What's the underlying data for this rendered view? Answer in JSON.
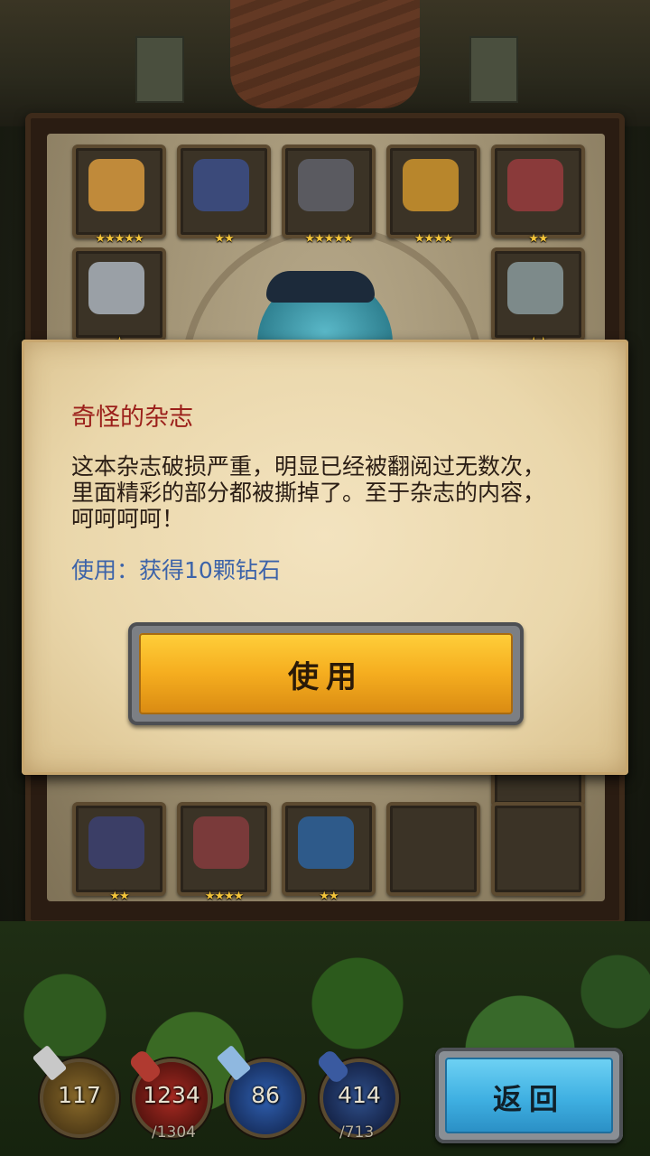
{
  "inventory": {
    "row1": [
      {
        "icon": "gauntlet-icon",
        "stars": "★★★★★",
        "color": "#c08a3a"
      },
      {
        "icon": "armor-vest-icon",
        "stars": "★★",
        "color": "#3b4a7a"
      },
      {
        "icon": "helmet-icon",
        "stars": "★★★★★",
        "color": "#5a5a60"
      },
      {
        "icon": "lantern-icon",
        "stars": "★★★★",
        "color": "#b8862c"
      },
      {
        "icon": "amulet-icon",
        "stars": "★★",
        "color": "#8a3a3a"
      }
    ],
    "row2": [
      {
        "icon": "silver-bracelet-icon",
        "stars": "★",
        "color": "#9aa0a6"
      },
      {
        "icon": "ring-icon",
        "stars": "★★",
        "color": "#7d8a8a"
      }
    ],
    "row_bottom": [
      {
        "icon": "dark-bracelet-icon",
        "stars": "★★",
        "color": "#3b3e66"
      },
      {
        "icon": "feathered-hat-icon",
        "stars": "★★★★",
        "color": "#7a3a3a"
      },
      {
        "icon": "blue-armor-icon",
        "stars": "★★",
        "color": "#2e5a8a"
      }
    ],
    "partial_row_star": "★★"
  },
  "dialog": {
    "title": "奇怪的杂志",
    "description": "这本杂志破损严重，明显已经被翻阅过无数次，里面精彩的部分都被撕掉了。至于杂志的内容，呵呵呵呵！",
    "effect": "使用：获得10颗钻石",
    "use_button": "使用"
  },
  "stats": [
    {
      "icon": "sword-icon",
      "value": "117",
      "max": "",
      "color": "#8a6a2a"
    },
    {
      "icon": "health-potion-icon",
      "value": "1234",
      "max": "/1304",
      "color": "#7a1f1a"
    },
    {
      "icon": "shield-icon",
      "value": "86",
      "max": "",
      "color": "#1f3f7a"
    },
    {
      "icon": "mana-potion-icon",
      "value": "414",
      "max": "/713",
      "color": "#1f3a6a"
    }
  ],
  "back_button": "返回",
  "colors": {
    "title_red": "#9b1f1a",
    "effect_blue": "#3c63a9",
    "star_gold": "#f3c43a",
    "use_button_orange": "#f5ad1f",
    "back_button_blue": "#3fb0e2"
  }
}
